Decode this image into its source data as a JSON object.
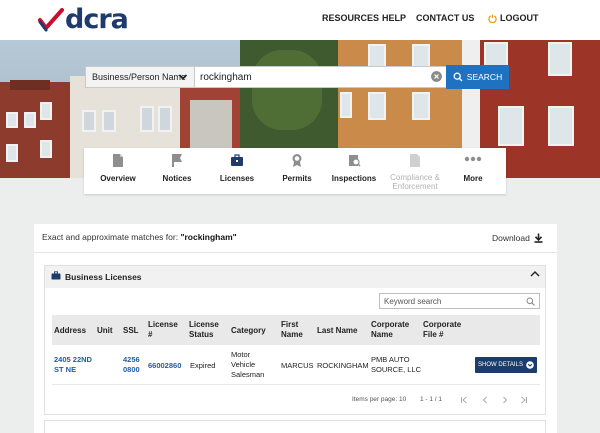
{
  "brand": {
    "logo_text": "dcra"
  },
  "topnav": {
    "resources": "RESOURCES",
    "help": "HELP",
    "contact": "CONTACT US",
    "logout": "LOGOUT"
  },
  "search": {
    "type_select": "Business/Person Name",
    "query": "rockingham",
    "button_label": "SEARCH"
  },
  "tabs": [
    {
      "label": "Overview",
      "icon": "document-icon",
      "enabled": true
    },
    {
      "label": "Notices",
      "icon": "flag-icon",
      "enabled": true
    },
    {
      "label": "Licenses",
      "icon": "briefcase-icon",
      "enabled": true
    },
    {
      "label": "Permits",
      "icon": "award-icon",
      "enabled": true
    },
    {
      "label": "Inspections",
      "icon": "inspection-icon",
      "enabled": true
    },
    {
      "label": "Compliance & Enforcement",
      "icon": "compliance-icon",
      "enabled": false
    },
    {
      "label": "More",
      "icon": "more-icon",
      "enabled": true
    }
  ],
  "results": {
    "match_prefix": "Exact and approximate matches for: ",
    "match_term": "\"rockingham\"",
    "download_label": "Download"
  },
  "business_licenses": {
    "title": "Business Licenses",
    "keyword_placeholder": "Keyword search",
    "columns": [
      "Address",
      "Unit",
      "SSL",
      "License #",
      "License Status",
      "Category",
      "First Name",
      "Last Name",
      "Corporate Name",
      "Corporate File #"
    ],
    "rows": [
      {
        "address": "2405 22ND ST NE",
        "unit": "",
        "ssl": "4256 0800",
        "license_no": "66002860",
        "status": "Expired",
        "category": "Motor Vehicle Salesman",
        "first_name": "MARCUS",
        "last_name": "ROCKINGHAM",
        "corporate_name": "PMB AUTO SOURCE, LLC",
        "corporate_file": ""
      }
    ],
    "show_details_label": "SHOW DETAILS",
    "items_per_page_label": "Items per page:",
    "items_per_page": "10",
    "range_label": "1 - 1 / 1"
  },
  "colors": {
    "brand_navy": "#1f3b6e",
    "brand_red": "#c8102e",
    "search_blue": "#1f72bf",
    "button_navy": "#1c3d6b",
    "link_blue": "#1f5ea6"
  }
}
